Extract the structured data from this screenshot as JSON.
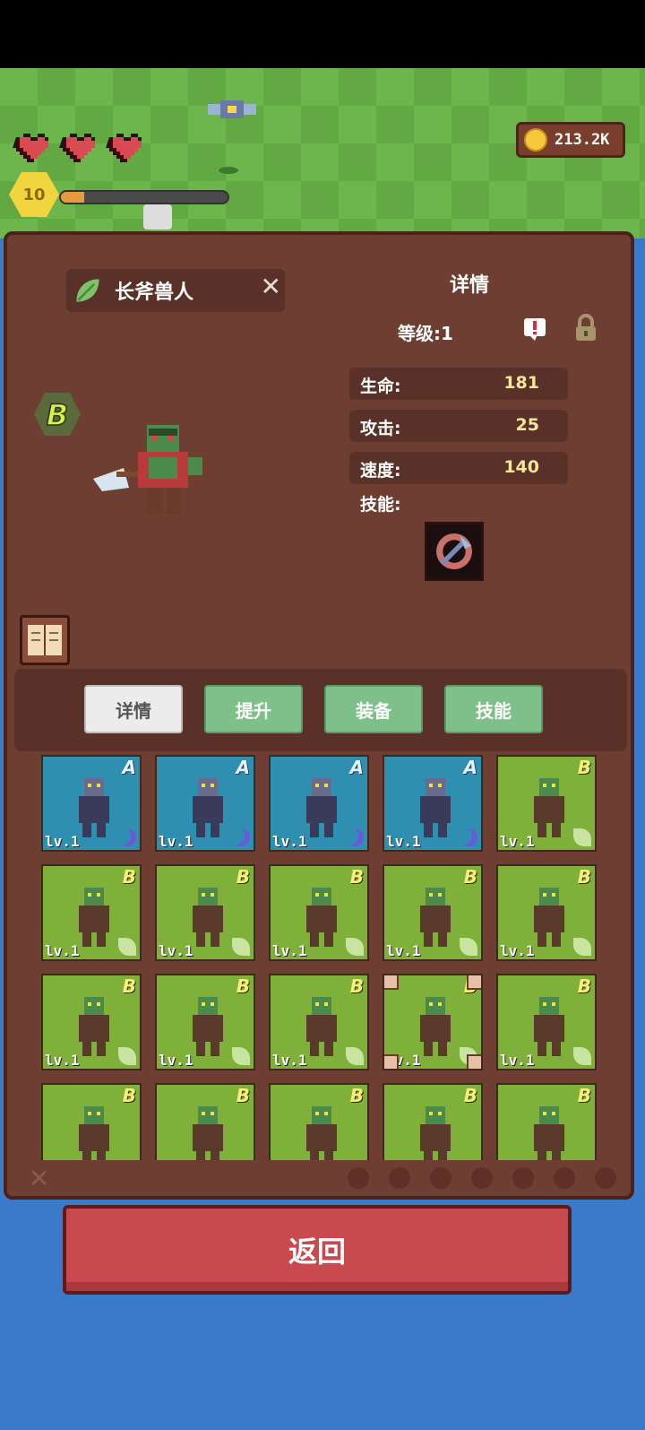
{
  "hud": {
    "hearts": 3,
    "gold": "213.2K",
    "player_level": "10",
    "xp_progress": 0.14
  },
  "unit": {
    "name": "长斧兽人",
    "rank": "B",
    "detail_title": "详情",
    "level": "等级:1",
    "stats": [
      {
        "label": "生命:",
        "value": "181"
      },
      {
        "label": "攻击:",
        "value": "25"
      },
      {
        "label": "速度:",
        "value": "140"
      }
    ],
    "skill_label": "技能:"
  },
  "tabs": [
    "详情",
    "提升",
    "装备",
    "技能"
  ],
  "active_tab": 0,
  "roster": [
    {
      "rank": "A",
      "lv": "lv.1",
      "color": "blue",
      "element": "moon"
    },
    {
      "rank": "A",
      "lv": "lv.1",
      "color": "blue",
      "element": "moon"
    },
    {
      "rank": "A",
      "lv": "lv.1",
      "color": "blue",
      "element": "moon"
    },
    {
      "rank": "A",
      "lv": "lv.1",
      "color": "blue",
      "element": "moon"
    },
    {
      "rank": "B",
      "lv": "lv.1",
      "color": "green",
      "element": "leaf"
    },
    {
      "rank": "B",
      "lv": "lv.1",
      "color": "green",
      "element": "leaf"
    },
    {
      "rank": "B",
      "lv": "lv.1",
      "color": "green",
      "element": "leaf"
    },
    {
      "rank": "B",
      "lv": "lv.1",
      "color": "green",
      "element": "leaf"
    },
    {
      "rank": "B",
      "lv": "lv.1",
      "color": "green",
      "element": "leaf"
    },
    {
      "rank": "B",
      "lv": "lv.1",
      "color": "green",
      "element": "leaf"
    },
    {
      "rank": "B",
      "lv": "lv.1",
      "color": "green",
      "element": "leaf"
    },
    {
      "rank": "B",
      "lv": "lv.1",
      "color": "green",
      "element": "leaf"
    },
    {
      "rank": "B",
      "lv": "lv.1",
      "color": "green",
      "element": "leaf"
    },
    {
      "rank": "B",
      "lv": "lv.1",
      "color": "green",
      "element": "leaf",
      "selected": true
    },
    {
      "rank": "B",
      "lv": "lv.1",
      "color": "green",
      "element": "leaf"
    },
    {
      "rank": "B",
      "lv": "",
      "color": "green",
      "element": ""
    },
    {
      "rank": "B",
      "lv": "",
      "color": "green",
      "element": ""
    },
    {
      "rank": "B",
      "lv": "",
      "color": "green",
      "element": ""
    },
    {
      "rank": "B",
      "lv": "",
      "color": "green",
      "element": ""
    },
    {
      "rank": "B",
      "lv": "",
      "color": "green",
      "element": ""
    }
  ],
  "back_button": "返回"
}
